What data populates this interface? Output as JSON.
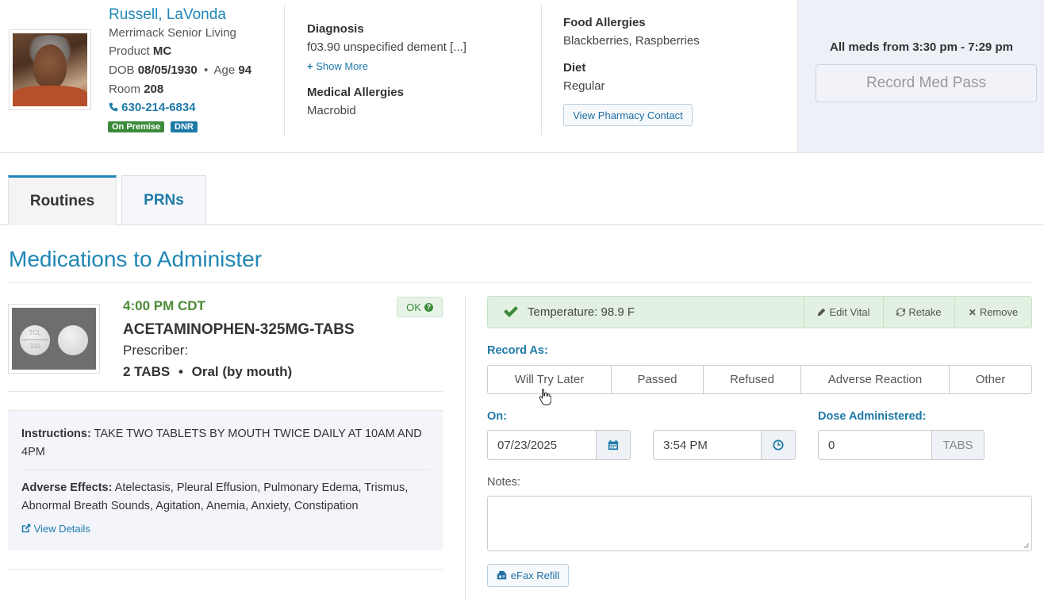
{
  "patient": {
    "name": "Russell, LaVonda",
    "facility": "Merrimack Senior Living",
    "product_label": "Product",
    "product_value": "MC",
    "dob_label": "DOB",
    "dob_value": "08/05/1930",
    "age_label": "Age",
    "age_value": "94",
    "room_label": "Room",
    "room_value": "208",
    "phone": "630-214-6834",
    "badges": {
      "on_premise": "On Premise",
      "dnr": "DNR"
    }
  },
  "diagnosis": {
    "label": "Diagnosis",
    "value": "f03.90 unspecified dement [...]",
    "show_more": "Show More",
    "medical_allergies_label": "Medical Allergies",
    "medical_allergies_value": "Macrobid"
  },
  "food": {
    "label": "Food Allergies",
    "value": "Blackberries, Raspberries",
    "diet_label": "Diet",
    "diet_value": "Regular",
    "pharmacy_button": "View Pharmacy Contact"
  },
  "med_pass": {
    "window_text": "All meds from 3:30 pm - 7:29 pm",
    "record_button": "Record Med Pass"
  },
  "tabs": [
    {
      "label": "Routines",
      "active": true
    },
    {
      "label": "PRNs",
      "active": false
    }
  ],
  "section_title": "Medications to Administer",
  "medication": {
    "time": "4:00 PM CDT",
    "status": "OK",
    "name": "ACETAMINOPHEN-325MG-TABS",
    "prescriber_label": "Prescriber:",
    "dose": "2 TABS",
    "route": "Oral (by mouth)",
    "pill_imprint_1": "TCL",
    "pill_imprint_2": "310",
    "instructions_label": "Instructions:",
    "instructions": "TAKE TWO TABLETS BY MOUTH TWICE DAILY AT 10AM AND 4PM",
    "adverse_label": "Adverse Effects:",
    "adverse": "Atelectasis, Pleural Effusion, Pulmonary Edema, Trismus, Abnormal Breath Sounds, Agitation, Anemia, Anxiety, Constipation",
    "view_details": "View Details"
  },
  "vital": {
    "text": "Temperature: 98.9 F",
    "edit": "Edit Vital",
    "retake": "Retake",
    "remove": "Remove"
  },
  "record": {
    "label": "Record As:",
    "options": [
      "Will Try Later",
      "Passed",
      "Refused",
      "Adverse Reaction",
      "Other"
    ],
    "on_label": "On:",
    "date": "07/23/2025",
    "time": "3:54 PM",
    "dose_label": "Dose Administered:",
    "dose_value": "0",
    "dose_unit": "TABS",
    "notes_label": "Notes:",
    "notes_value": "",
    "efax": "eFax Refill"
  },
  "colors": {
    "accent": "#1f86b5",
    "success": "#4c8a35",
    "badge_green": "#3c8a3c",
    "badge_blue": "#1f7aa8"
  }
}
